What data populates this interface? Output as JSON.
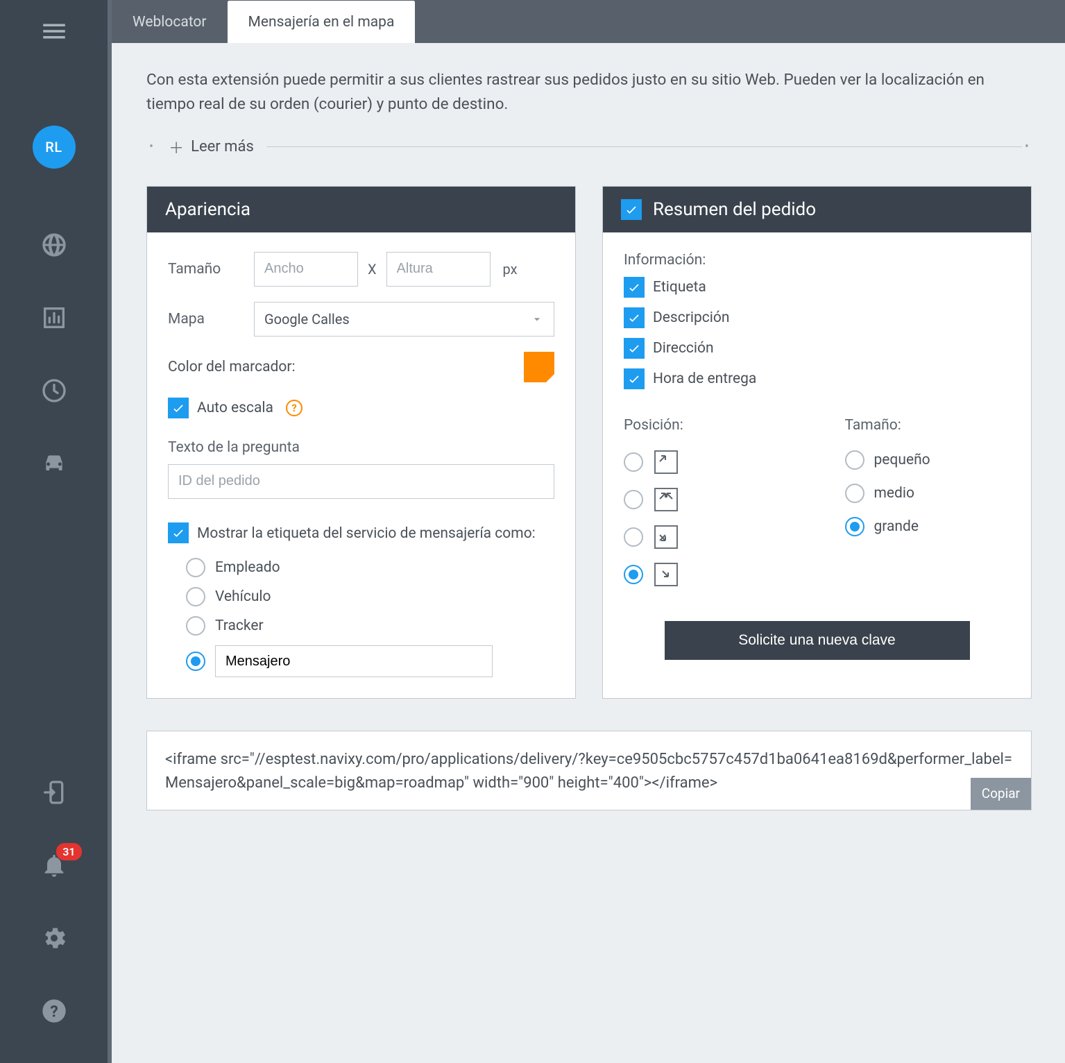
{
  "sidebar": {
    "avatar_initials": "RL",
    "notification_count": "31"
  },
  "tabs": {
    "weblocator": "Weblocator",
    "messaging": "Mensajería en el mapa"
  },
  "intro": "Con esta extensión puede permitir a sus clientes rastrear sus pedidos justo en su sitio Web. Pueden ver la localización en tiempo real de su orden (courier) y punto de destino.",
  "readmore": "Leer más",
  "appearance": {
    "title": "Apariencia",
    "size_label": "Tamaño",
    "width_placeholder": "Ancho",
    "x": "X",
    "height_placeholder": "Altura",
    "unit": "px",
    "map_label": "Mapa",
    "map_value": "Google Calles",
    "marker_color_label": "Color del marcador:",
    "marker_color": "#ff8a00",
    "auto_scale": "Auto escala",
    "question_text_label": "Texto de la pregunta",
    "question_placeholder": "ID del pedido",
    "show_label": "Mostrar la etiqueta del servicio de mensajería como:",
    "radios": {
      "employee": "Empleado",
      "vehicle": "Vehículo",
      "tracker": "Tracker",
      "custom_value": "Mensajero"
    }
  },
  "summary": {
    "title": "Resumen del pedido",
    "info_label": "Información:",
    "info_items": {
      "label": "Etiqueta",
      "description": "Descripción",
      "address": "Dirección",
      "delivery": "Hora de entrega"
    },
    "position_label": "Posición:",
    "size_label": "Tamaño:",
    "sizes": {
      "small": "pequeño",
      "medium": "medio",
      "large": "grande"
    },
    "request_key": "Solicite una nueva clave"
  },
  "codebox": {
    "text": "<iframe src=\"//esptest.navixy.com/pro/applications/delivery/?key=ce9505cbc5757c457d1ba0641ea8169d&performer_label=Mensajero&panel_scale=big&map=roadmap\" width=\"900\" height=\"400\"></iframe>",
    "copy": "Copiar"
  }
}
